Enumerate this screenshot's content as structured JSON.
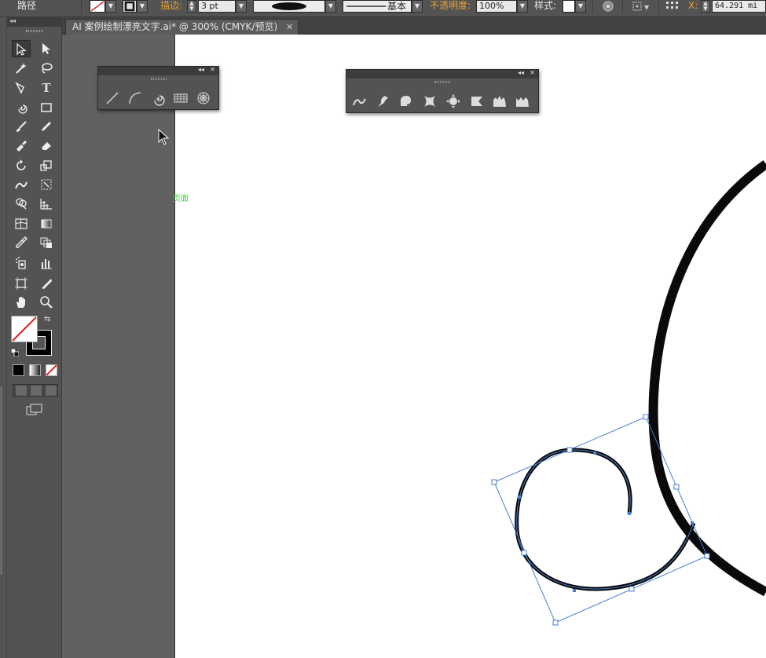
{
  "control_bar": {
    "selection_type": "路径",
    "stroke_label": "描边:",
    "stroke_weight": "3 pt",
    "stroke_style": "基本",
    "opacity_label": "不透明度:",
    "opacity_value": "100%",
    "style_label": "样式:",
    "x_label": "X:",
    "x_value": "64.291 mi",
    "dropdown_glyph": "▼"
  },
  "document": {
    "tab_title": "AI 案例绘制漂亮文字.ai* @ 300% (CMYK/预览)",
    "close_glyph": "✕"
  },
  "tools_panel": {
    "collapse_glyph": "◂◂"
  },
  "line_tools_panel": {
    "collapse_glyph": "◂◂",
    "close_glyph": "✕",
    "tools": [
      "line-segment-icon",
      "arc-icon",
      "spiral-icon",
      "rectangular-grid-icon",
      "polar-grid-icon"
    ]
  },
  "warp_tools_panel": {
    "collapse_glyph": "◂◂",
    "close_glyph": "✕",
    "tools": [
      "width-icon",
      "warp-icon",
      "twirl-icon",
      "pucker-icon",
      "bloat-icon",
      "scallop-icon",
      "crystallize-icon",
      "wrinkle-icon"
    ]
  },
  "canvas": {
    "page_label": "页面"
  },
  "colors": {
    "selection": "#4a7fd0",
    "page_label": "#41d341",
    "accent_label": "#e8a23a"
  }
}
